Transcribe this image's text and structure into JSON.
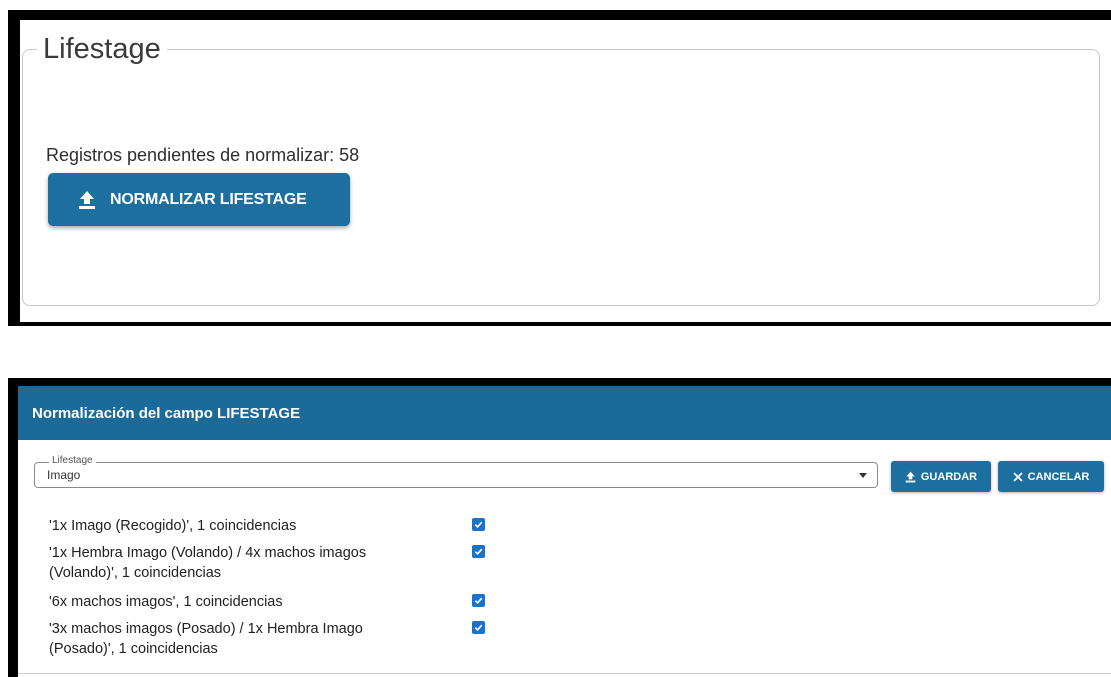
{
  "lifestage_panel": {
    "legend": "Lifestage",
    "pending_label": "Registros pendientes de normalizar: 58",
    "normalize_button": "NORMALIZAR LIFESTAGE",
    "icon": "upload-icon"
  },
  "dialog": {
    "title": "Normalización del campo LIFESTAGE",
    "select": {
      "label": "Lifestage",
      "value": "Imago"
    },
    "save_button": "GUARDAR",
    "cancel_button": "CANCELAR",
    "items": [
      {
        "text": "'1x Imago (Recogido)', 1 coincidencias",
        "checked": true
      },
      {
        "text": "'1x Hembra Imago (Volando) / 4x machos imagos (Volando)', 1 coincidencias",
        "checked": true
      },
      {
        "text": "'6x machos imagos', 1 coincidencias",
        "checked": true
      },
      {
        "text": "'3x machos imagos (Posado) / 1x Hembra Imago (Posado)', 1 coincidencias",
        "checked": true
      }
    ],
    "colors": {
      "header": "#1b6a99",
      "button": "#1d6f9f",
      "checkbox": "#1a73c9"
    }
  }
}
